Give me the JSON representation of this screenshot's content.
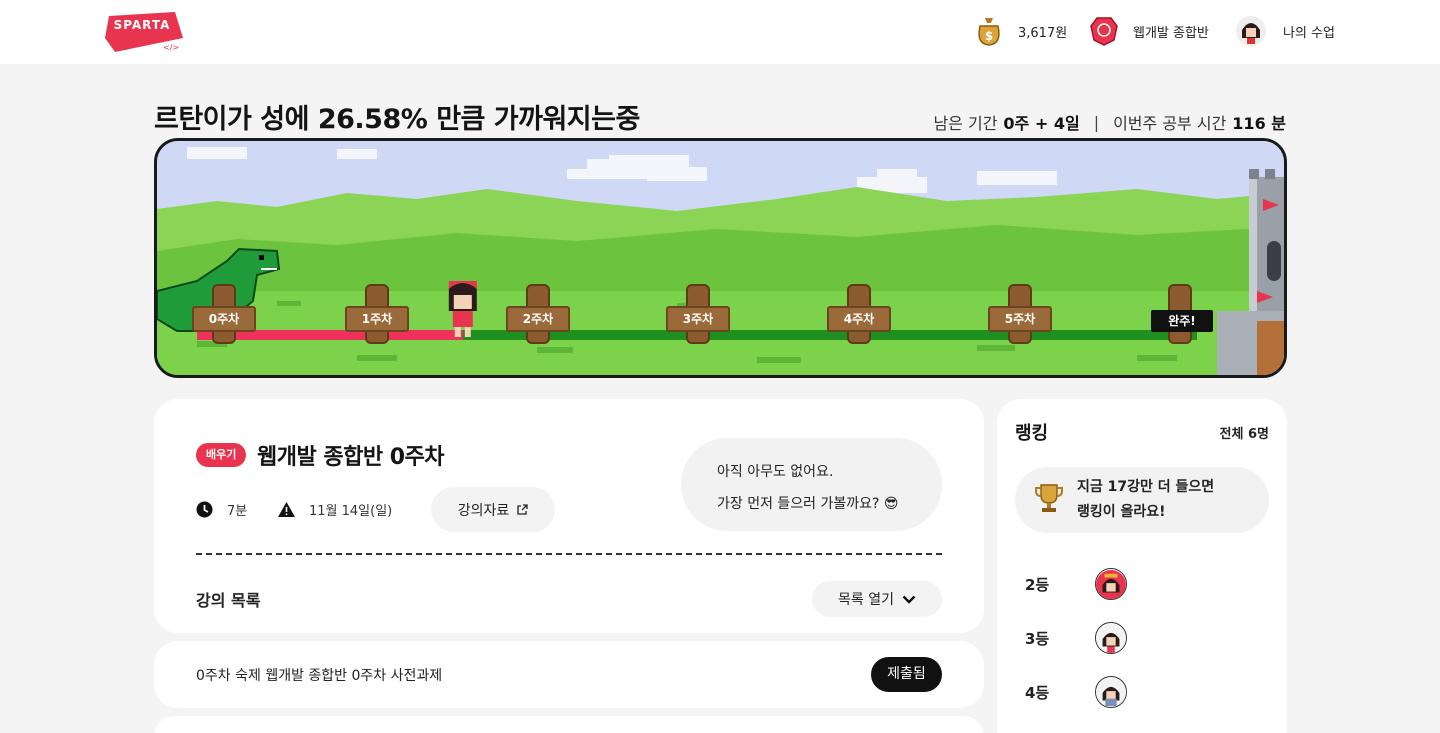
{
  "header": {
    "logo_text": "SPARTA",
    "point": "3,617원",
    "course": "웹개발 종합반",
    "my_course": "나의 수업"
  },
  "progress": {
    "title": "르탄이가 성에 26.58% 만큼 가까워지는중",
    "percent": 26.58,
    "remain_label": "남은 기간",
    "remain_value": "0주 + 4일",
    "study_label": "이번주 공부 시간",
    "study_value": "116 분"
  },
  "game": {
    "milestones": [
      "0주차",
      "1주차",
      "2주차",
      "3주차",
      "4주차",
      "5주차"
    ],
    "finish_label": "완주!",
    "colors": {
      "done_track": "#f0325a",
      "todo_track": "#1f8f1f",
      "grass": "#7cd24a"
    }
  },
  "lesson": {
    "badge": "배우기",
    "title": "웹개발 종합반 0주차",
    "duration": "7분",
    "deadline": "11월 14일(일)",
    "material_btn": "강의자료",
    "bubble_line1": "아직 아무도 없어요.",
    "bubble_line2": "가장 먼저 들으러 가볼까요? 😎",
    "list_label": "강의 목록",
    "list_btn": "목록 열기"
  },
  "homework": {
    "text": "0주차 숙제 웹개발 종합반 0주차 사전과제",
    "button": "제출됨"
  },
  "ranking": {
    "title": "랭킹",
    "total": "전체 6명",
    "banner_line1": "지금 17강만 더 들으면",
    "banner_line2": "랭킹이 올라요!",
    "rows": [
      {
        "pos": "2등"
      },
      {
        "pos": "3등"
      },
      {
        "pos": "4등"
      }
    ]
  }
}
